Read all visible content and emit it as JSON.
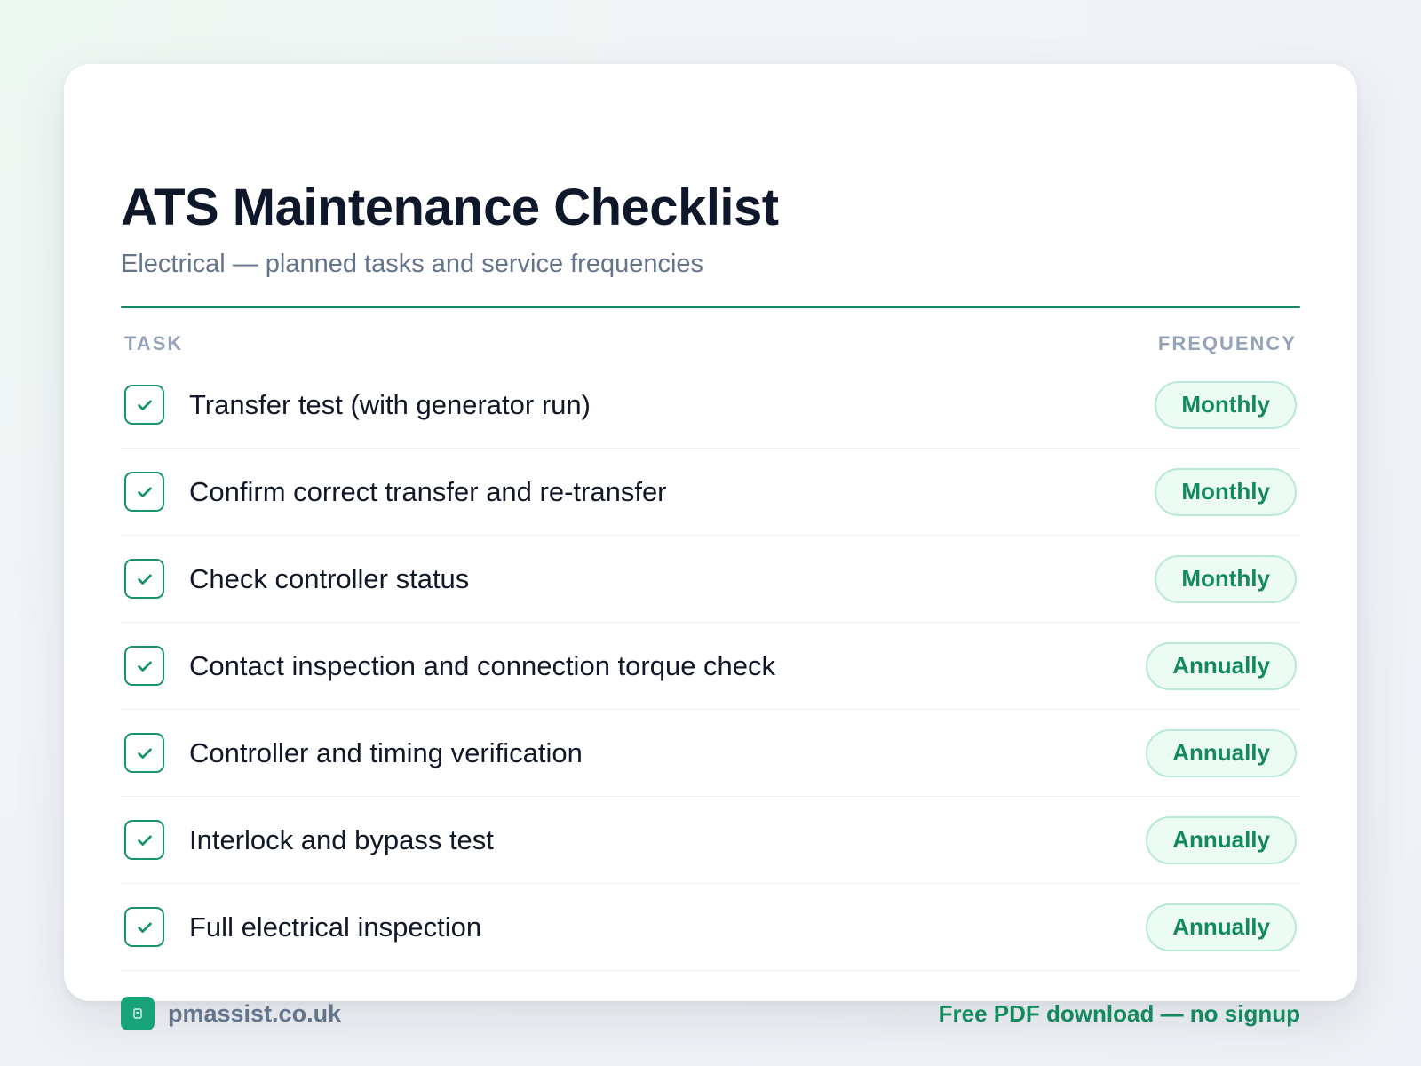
{
  "header": {
    "title": "ATS Maintenance Checklist",
    "subtitle": "Electrical — planned tasks and service frequencies"
  },
  "columns": {
    "task": "TASK",
    "frequency": "FREQUENCY"
  },
  "tasks": [
    {
      "label": "Transfer test (with generator run)",
      "frequency": "Monthly",
      "checked": true
    },
    {
      "label": "Confirm correct transfer and re-transfer",
      "frequency": "Monthly",
      "checked": true
    },
    {
      "label": "Check controller status",
      "frequency": "Monthly",
      "checked": true
    },
    {
      "label": "Contact inspection and connection torque check",
      "frequency": "Annually",
      "checked": true
    },
    {
      "label": "Controller and timing verification",
      "frequency": "Annually",
      "checked": true
    },
    {
      "label": "Interlock and bypass test",
      "frequency": "Annually",
      "checked": true
    },
    {
      "label": "Full electrical inspection",
      "frequency": "Annually",
      "checked": true
    }
  ],
  "footer": {
    "brand": "pmassist.co.uk",
    "brand_icon": "building-icon",
    "cta": "Free PDF download — no signup"
  },
  "colors": {
    "accent": "#15875f",
    "pill_bg": "#ecfbf3",
    "pill_border": "#b7ead2",
    "title": "#0f172a",
    "muted": "#64748b"
  }
}
